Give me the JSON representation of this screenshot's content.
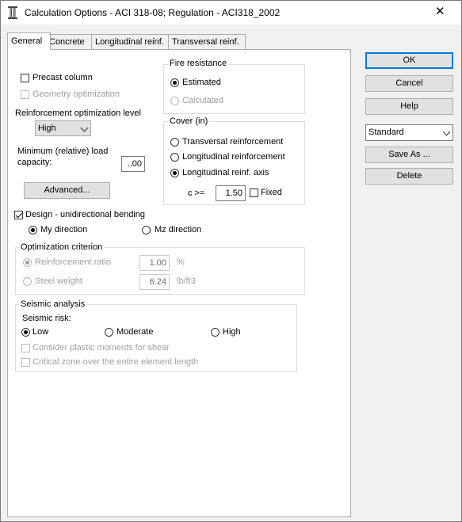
{
  "window": {
    "title": "Calculation Options - ACI 318-08;  Regulation - ACI318_2002",
    "close_glyph": "✕"
  },
  "tabs": [
    {
      "label": "General",
      "active": true
    },
    {
      "label": "Concrete",
      "active": false
    },
    {
      "label": "Longitudinal reinf.",
      "active": false
    },
    {
      "label": "Transversal reinf.",
      "active": false
    }
  ],
  "general": {
    "precast_column": {
      "label": "Precast column",
      "checked": false
    },
    "geometry_optimization": {
      "label": "Geometry optimization",
      "checked": false,
      "enabled": false
    },
    "reinf_opt_level": {
      "label": "Reinforcement optimization level",
      "value": "High"
    },
    "min_load": {
      "label1": "Minimum (relative) load",
      "label2": "capacity:",
      "value": "..00"
    },
    "advanced_label": "Advanced...",
    "fire_resistance": {
      "title": "Fire resistance",
      "estimated": "Estimated",
      "calculated": "Calculated",
      "selected": "estimated"
    },
    "cover": {
      "title": "Cover (in)",
      "transversal": "Transversal reinforcement",
      "longitudinal": "Longitudinal reinforcement",
      "axis": "Longitudinal reinf. axis",
      "selected": "axis",
      "c_label": "c >=",
      "c_value": "1.50",
      "fixed_label": "Fixed",
      "fixed_checked": false
    },
    "design_unidirectional": {
      "label": "Design - unidirectional bending",
      "checked": true
    },
    "direction": {
      "my": "My direction",
      "mz": "Mz direction",
      "selected": "my"
    },
    "optimization": {
      "title": "Optimization criterion",
      "reinf_ratio": {
        "label": "Reinforcement ratio",
        "value": "1.00",
        "unit": "%"
      },
      "steel_weight": {
        "label": "Steel weight",
        "value": "6.24",
        "unit": "lb/ft3"
      },
      "selected": "reinf_ratio"
    },
    "seismic": {
      "title": "Seismic analysis",
      "risk_label": "Seismic risk:",
      "low": "Low",
      "moderate": "Moderate",
      "high": "High",
      "selected": "low",
      "plastic_moments": "Consider plastic moments for shear",
      "critical_zone": "Critical zone over the entire element length"
    }
  },
  "side": {
    "ok": "OK",
    "cancel": "Cancel",
    "help": "Help",
    "preset": "Standard",
    "save_as": "Save As ...",
    "delete": "Delete"
  },
  "colors": {
    "accent": "#0078d7",
    "disabled_text": "#a0a0a0"
  }
}
